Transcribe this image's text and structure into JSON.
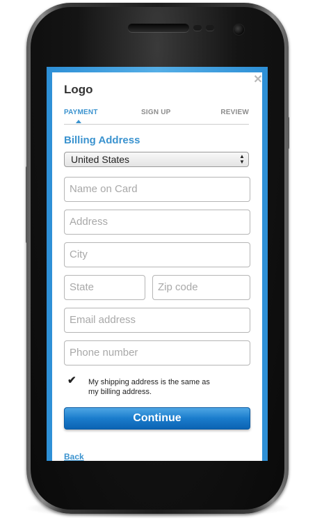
{
  "header": {
    "logo_text": "Logo",
    "close_icon": "close-icon"
  },
  "steps": [
    {
      "label": "PAYMENT",
      "active": true
    },
    {
      "label": "SIGN UP",
      "active": false
    },
    {
      "label": "REVIEW",
      "active": false
    }
  ],
  "form": {
    "section_title": "Billing Address",
    "country": {
      "selected": "United States",
      "icon": "select-arrows-icon"
    },
    "fields": {
      "name": {
        "placeholder": "Name on Card",
        "value": ""
      },
      "address": {
        "placeholder": "Address",
        "value": ""
      },
      "city": {
        "placeholder": "City",
        "value": ""
      },
      "state": {
        "placeholder": "State",
        "value": ""
      },
      "zip": {
        "placeholder": "Zip code",
        "value": ""
      },
      "email": {
        "placeholder": "Email address",
        "value": ""
      },
      "phone": {
        "placeholder": "Phone number",
        "value": ""
      }
    },
    "same_address": {
      "checked": true,
      "label_line1": "My shipping address is the same as",
      "label_line2": "my billing address."
    },
    "continue_label": "Continue",
    "back_label": "Back"
  },
  "colors": {
    "accent": "#3b93cf",
    "button": "#1a7ccc",
    "screen_frame": "#2d8fd6"
  }
}
